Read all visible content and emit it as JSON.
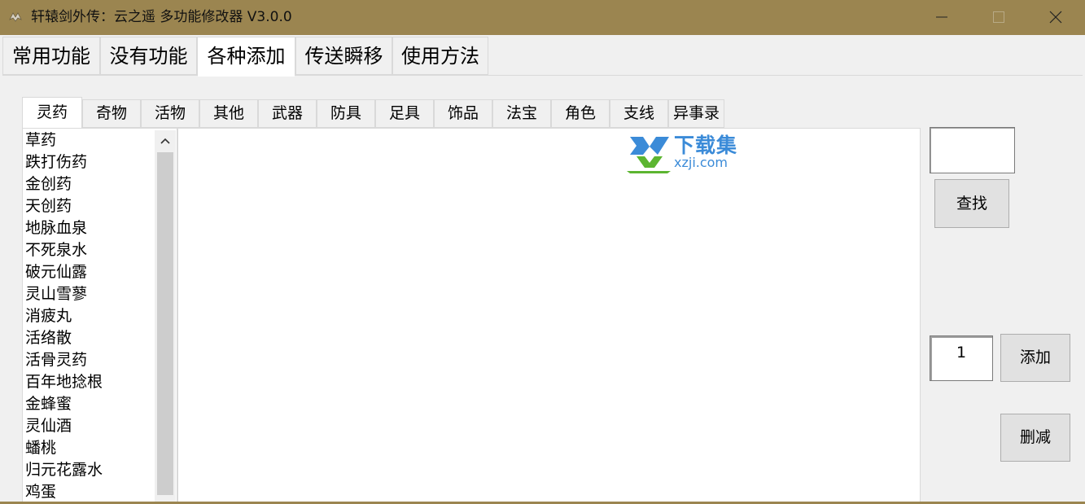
{
  "window": {
    "title": "轩辕剑外传：云之遥 多功能修改器  V3.0.0",
    "frame_color": "#9b8550",
    "controls": [
      "minimize-icon",
      "maximize-icon",
      "close-icon"
    ]
  },
  "main_tabs": [
    {
      "label": "常用功能"
    },
    {
      "label": "没有功能"
    },
    {
      "label": "各种添加",
      "active": true
    },
    {
      "label": "传送瞬移"
    },
    {
      "label": "使用方法"
    }
  ],
  "sub_tabs": [
    {
      "label": "灵药",
      "active": true
    },
    {
      "label": "奇物"
    },
    {
      "label": "活物"
    },
    {
      "label": "其他"
    },
    {
      "label": "武器"
    },
    {
      "label": "防具"
    },
    {
      "label": "足具"
    },
    {
      "label": "饰品"
    },
    {
      "label": "法宝"
    },
    {
      "label": "角色"
    },
    {
      "label": "支线"
    },
    {
      "label": "异事录"
    }
  ],
  "item_list": [
    "草药",
    "跌打伤药",
    "金创药",
    "天创药",
    "地脉血泉",
    "不死泉水",
    "破元仙露",
    "灵山雪蓼",
    "消疲丸",
    "活络散",
    "活骨灵药",
    "百年地捻根",
    "金蜂蜜",
    "灵仙酒",
    "蟠桃",
    "归元花露水",
    "鸡蛋"
  ],
  "watermark": {
    "cn": "下载集",
    "en": "xzji.com",
    "color": "#3b8bd8",
    "accent_green": "#5cb531"
  },
  "side": {
    "search_value": "",
    "search_button": "查找",
    "quantity_value": "1",
    "add_button": "添加",
    "reduce_button": "删减"
  }
}
